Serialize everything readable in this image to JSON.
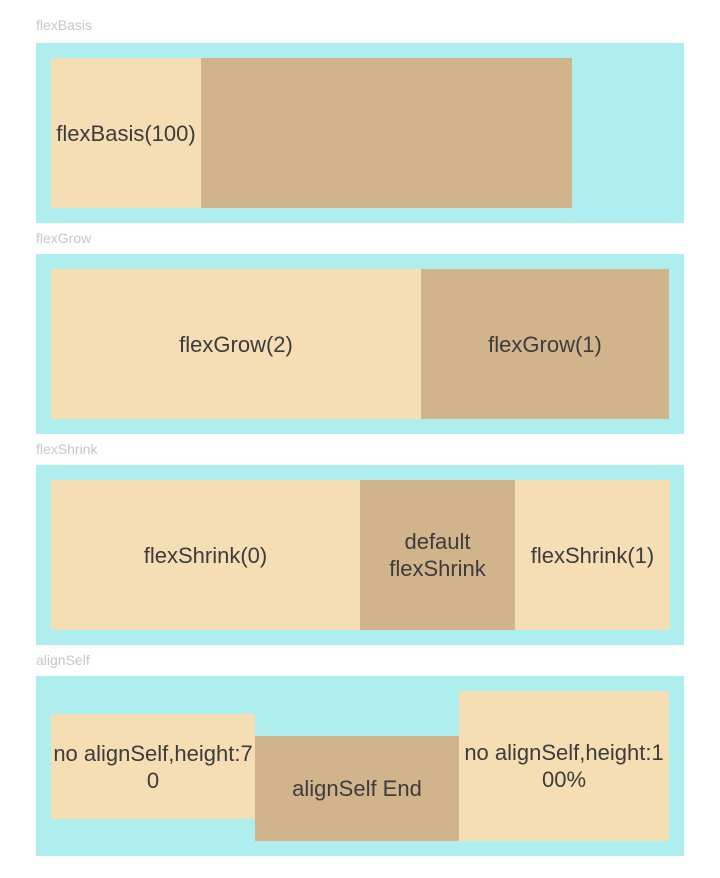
{
  "sections": [
    {
      "label": "flexBasis",
      "items": [
        {
          "text": "flexBasis(100)"
        },
        {
          "text": ""
        }
      ]
    },
    {
      "label": "flexGrow",
      "items": [
        {
          "text": "flexGrow(2)"
        },
        {
          "text": "flexGrow(1)"
        }
      ]
    },
    {
      "label": "flexShrink",
      "items": [
        {
          "text": "flexShrink(0)"
        },
        {
          "text": "default flexShrink"
        },
        {
          "text": "flexShrink(1)"
        }
      ]
    },
    {
      "label": "alignSelf",
      "items": [
        {
          "text": "no alignSelf,height:70"
        },
        {
          "text": "alignSelf End"
        },
        {
          "text": "no alignSelf,height:100%"
        }
      ]
    }
  ],
  "colors": {
    "container_bg": "#afeeee",
    "item_light": "#f5deb3",
    "item_dark": "#d2b48c",
    "label_text": "#c6c6c6",
    "item_text": "#3c3c3c"
  }
}
